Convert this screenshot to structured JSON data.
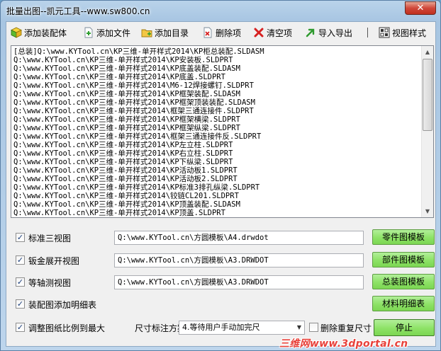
{
  "window": {
    "title": "批量出图--凯元工具--www.sw800.cn",
    "close_label": "✕"
  },
  "toolbar": {
    "buttons": [
      {
        "label": "添加装配体",
        "icon": "cube-icon"
      },
      {
        "label": "添加文件",
        "icon": "add-file-icon"
      },
      {
        "label": "添加目录",
        "icon": "folder-icon"
      },
      {
        "label": "删除项",
        "icon": "delete-file-icon"
      },
      {
        "label": "清空项",
        "icon": "red-x-icon"
      },
      {
        "label": "导入导出",
        "icon": "green-arrow-icon"
      },
      {
        "label": "视图样式",
        "icon": "view-style-icon"
      }
    ]
  },
  "file_list": {
    "rows": [
      "[总装]Q:\\www.KYTool.cn\\KP三维-单开样式2014\\KP柜总装配.SLDASM",
      "Q:\\www.KYTool.cn\\KP三维-单开样式2014\\KP安装板.SLDPRT",
      "Q:\\www.KYTool.cn\\KP三维-单开样式2014\\KP底盖装配.SLDASM",
      "Q:\\www.KYTool.cn\\KP三维-单开样式2014\\KP底盖.SLDPRT",
      "Q:\\www.KYTool.cn\\KP三维-单开样式2014\\M6-12焊接螺钉.SLDPRT",
      "Q:\\www.KYTool.cn\\KP三维-单开样式2014\\KP框架装配.SLDASM",
      "Q:\\www.KYTool.cn\\KP三维-单开样式2014\\KP框架顶装装配.SLDASM",
      "Q:\\www.KYTool.cn\\KP三维-单开样式2014\\框架三通连接件.SLDPRT",
      "Q:\\www.KYTool.cn\\KP三维-单开样式2014\\KP框架横梁.SLDPRT",
      "Q:\\www.KYTool.cn\\KP三维-单开样式2014\\KP框架纵梁.SLDPRT",
      "Q:\\www.KYTool.cn\\KP三维-单开样式2014\\框架三通连接件反.SLDPRT",
      "Q:\\www.KYTool.cn\\KP三维-单开样式2014\\KP左立柱.SLDPRT",
      "Q:\\www.KYTool.cn\\KP三维-单开样式2014\\KP右立柱.SLDPRT",
      "Q:\\www.KYTool.cn\\KP三维-单开样式2014\\KP下纵梁.SLDPRT",
      "Q:\\www.KYTool.cn\\KP三维-单开样式2014\\KP活动板1.SLDPRT",
      "Q:\\www.KYTool.cn\\KP三维-单开样式2014\\KP活动板2.SLDPRT",
      "Q:\\www.KYTool.cn\\KP三维-单开样式2014\\KP标准3排孔纵梁.SLDPRT",
      "Q:\\www.KYTool.cn\\KP三维-单开样式2014\\铰链CL201.SLDPRT",
      "Q:\\www.KYTool.cn\\KP三维-单开样式2014\\KP顶盖装配.SLDASM",
      "Q:\\www.KYTool.cn\\KP三维-单开样式2014\\KP顶盖.SLDPRT"
    ]
  },
  "options": [
    {
      "label": "标准三视图",
      "checked": true,
      "path": "Q:\\www.KYTool.cn\\方圆模板\\A4.drwdot",
      "button": "零件图模板"
    },
    {
      "label": "钣金展开视图",
      "checked": true,
      "path": "Q:\\www.KYTool.cn\\方圆模板\\A3.DRWDOT",
      "button": "部件图模板"
    },
    {
      "label": "等轴测视图",
      "checked": true,
      "path": "Q:\\www.KYTool.cn\\方圆模板\\A3.DRWDOT",
      "button": "总装图模板"
    },
    {
      "label": "装配图添加明细表",
      "checked": true,
      "path": "",
      "button": "材料明细表"
    }
  ],
  "bottom": {
    "scale_label": "调整图纸比例到最大",
    "scale_checked": true,
    "dim_label": "尺寸标注方案:",
    "dim_value": "4.等待用户手动加完尺",
    "dedupe_label": "删除重复尺寸",
    "dedupe_checked": false,
    "stop_label": "停止"
  },
  "watermark": "三维网www.3dportal.cn"
}
